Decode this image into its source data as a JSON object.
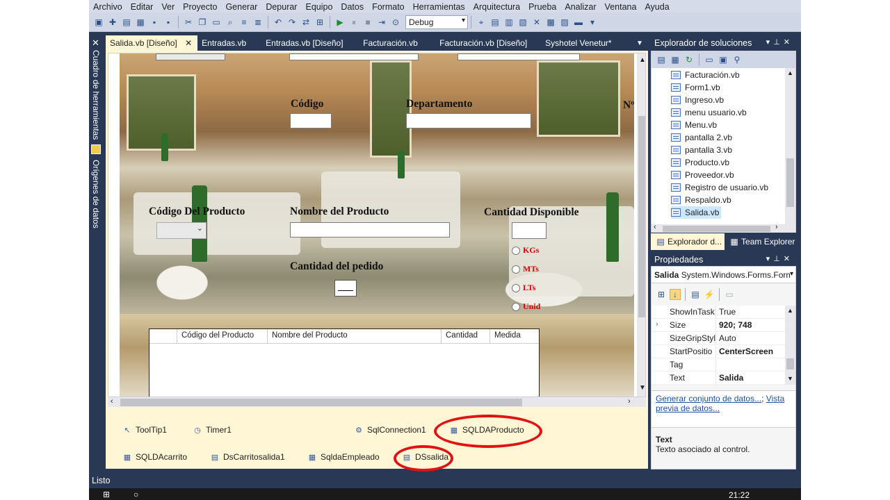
{
  "menu": [
    "Archivo",
    "Editar",
    "Ver",
    "Proyecto",
    "Generar",
    "Depurar",
    "Equipo",
    "Datos",
    "Formato",
    "Herramientas",
    "Arquitectura",
    "Prueba",
    "Analizar",
    "Ventana",
    "Ayuda"
  ],
  "toolbar": {
    "config": "Debug"
  },
  "side_strip": {
    "toolbox": "Cuadro de herramientas",
    "datasources": "Orígenes de datos"
  },
  "tabs": [
    {
      "label": "Salida.vb [Diseño]",
      "active": true,
      "close": "✕"
    },
    {
      "label": "Entradas.vb"
    },
    {
      "label": "Entradas.vb [Diseño]"
    },
    {
      "label": "Facturación.vb"
    },
    {
      "label": "Facturación.vb [Diseño]"
    },
    {
      "label": "Syshotel Venetur*"
    }
  ],
  "form": {
    "codigo_label": "Código",
    "departamento_label": "Departamento",
    "numero_label": "Nº",
    "codigo_producto_label": "Código Del Producto",
    "nombre_producto_label": "Nombre del Producto",
    "cantidad_disponible_label": "Cantidad Disponible",
    "cantidad_pedido_label": "Cantidad del pedido",
    "units": [
      "KGs",
      "MTs",
      "LTs",
      "Unid"
    ],
    "grid_columns": [
      "",
      "Código del Producto",
      "Nombre del Producto",
      "Cantidad",
      "Medida"
    ]
  },
  "tray": {
    "items": [
      "ToolTip1",
      "Timer1",
      "SqlConnection1",
      "SQLDAProducto",
      "SQLDAcarrito",
      "DsCarritosalida1",
      "SqldaEmpleado",
      "DSsalida"
    ]
  },
  "solution_explorer": {
    "title": "Explorador de soluciones",
    "items": [
      "Facturación.vb",
      "Form1.vb",
      "Ingreso.vb",
      "menu usuario.vb",
      "Menu.vb",
      "pantalla 2.vb",
      "pantalla 3.vb",
      "Producto.vb",
      "Proveedor.vb",
      "Registro de usuario.vb",
      "Respaldo.vb",
      "Salida.vb"
    ],
    "selected": "Salida.vb",
    "tabs": [
      "Explorador d...",
      "Team Explorer"
    ]
  },
  "properties": {
    "title": "Propiedades",
    "object_name": "Salida",
    "object_type": "System.Windows.Forms.Form",
    "rows": [
      {
        "name": "ShowInTask",
        "value": "True"
      },
      {
        "name": "Size",
        "value": "920; 748"
      },
      {
        "name": "SizeGripStyl",
        "value": "Auto"
      },
      {
        "name": "StartPositio",
        "value": "CenterScreen"
      },
      {
        "name": "Tag",
        "value": ""
      },
      {
        "name": "Text",
        "value": "Salida"
      }
    ],
    "link1": "Generar conjunto de datos...",
    "link_sep": "; ",
    "link2": "Vista previa de datos...",
    "desc_title": "Text",
    "desc_text": "Texto asociado al control."
  },
  "status": "Listo",
  "taskbar": {
    "time": "21:22"
  },
  "colors": {
    "shell": "#293955",
    "designer_bg": "#fff6d5",
    "highlight": "#e21212"
  }
}
